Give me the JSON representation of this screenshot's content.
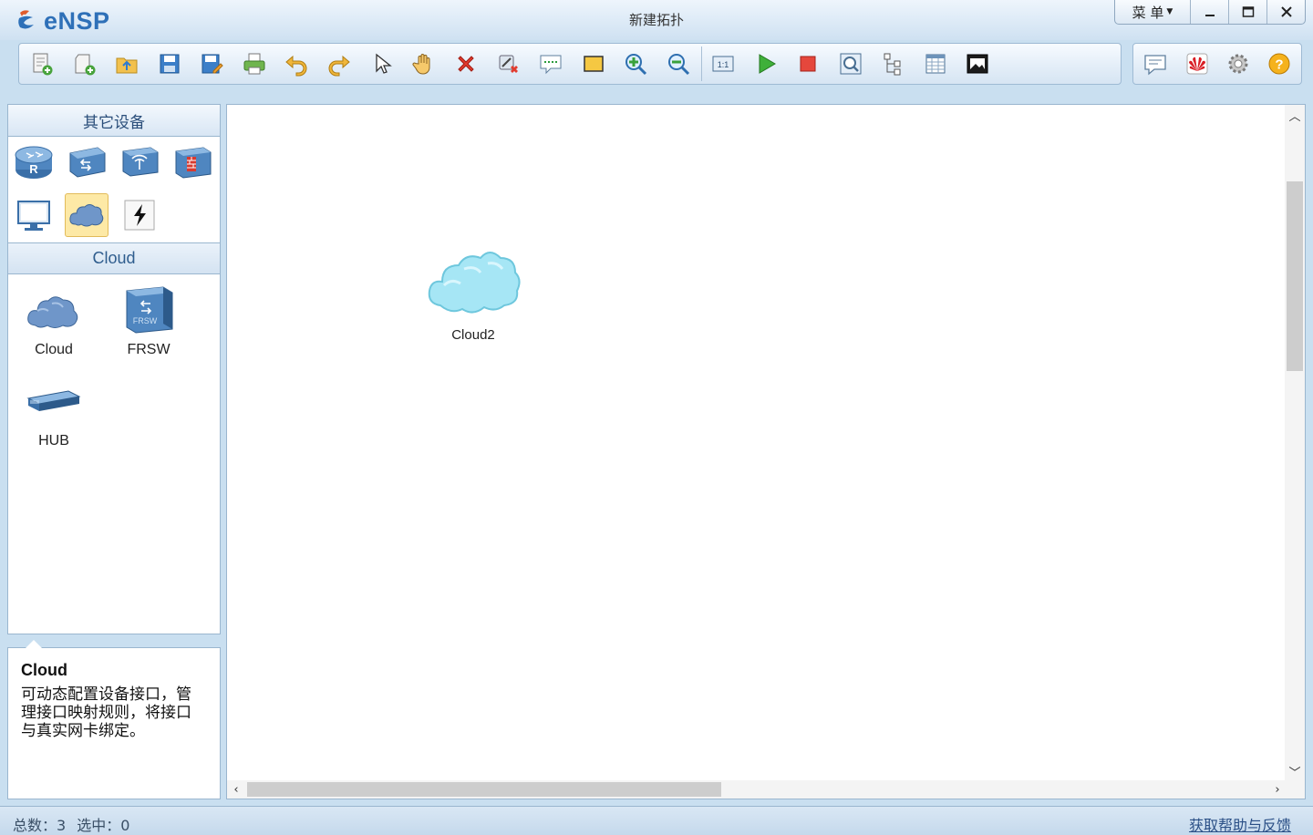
{
  "app": {
    "logo_text": "eNSP",
    "window_title": "新建拓扑",
    "menu_label": "菜 单",
    "controls": {
      "minimize": "minimize-icon",
      "maximize": "maximize-icon",
      "close": "close-icon"
    }
  },
  "toolbar": {
    "left_icons": [
      "new-topology-icon",
      "new-lab-icon",
      "open-icon",
      "save-icon",
      "save-as-icon",
      "print-icon",
      "undo-icon",
      "redo-icon",
      "select-pointer-icon",
      "pan-hand-icon",
      "delete-icon",
      "delete-link-icon",
      "text-label-icon",
      "rectangle-icon",
      "zoom-in-icon",
      "zoom-out-icon",
      "fit-view-icon",
      "start-device-icon",
      "stop-device-icon",
      "capture-icon",
      "topology-tree-icon",
      "grid-icon",
      "screenshot-icon"
    ],
    "right_icons": [
      "message-icon",
      "huawei-icon",
      "settings-gear-icon",
      "help-icon"
    ]
  },
  "left_panel": {
    "category_header": "其它设备",
    "categories": [
      "router-icon",
      "switch-icon",
      "wireless-icon",
      "firewall-icon",
      "pc-terminal-icon",
      "cloud-icon",
      "custom-link-icon"
    ],
    "selected_category": "Cloud",
    "devices": [
      {
        "label": "Cloud",
        "icon": "cloud-icon"
      },
      {
        "label": "FRSW",
        "icon": "frsw-icon"
      },
      {
        "label": "HUB",
        "icon": "hub-icon"
      }
    ]
  },
  "description": {
    "title": "Cloud",
    "text": "可动态配置设备接口，管理接口映射规则，将接口与真实网卡绑定。"
  },
  "canvas": {
    "nodes": [
      {
        "label": "Cloud2",
        "icon": "cloud-icon"
      }
    ]
  },
  "status": {
    "total": "总数：3",
    "selected": "选中：0",
    "help_link": "获取帮助与反馈"
  }
}
